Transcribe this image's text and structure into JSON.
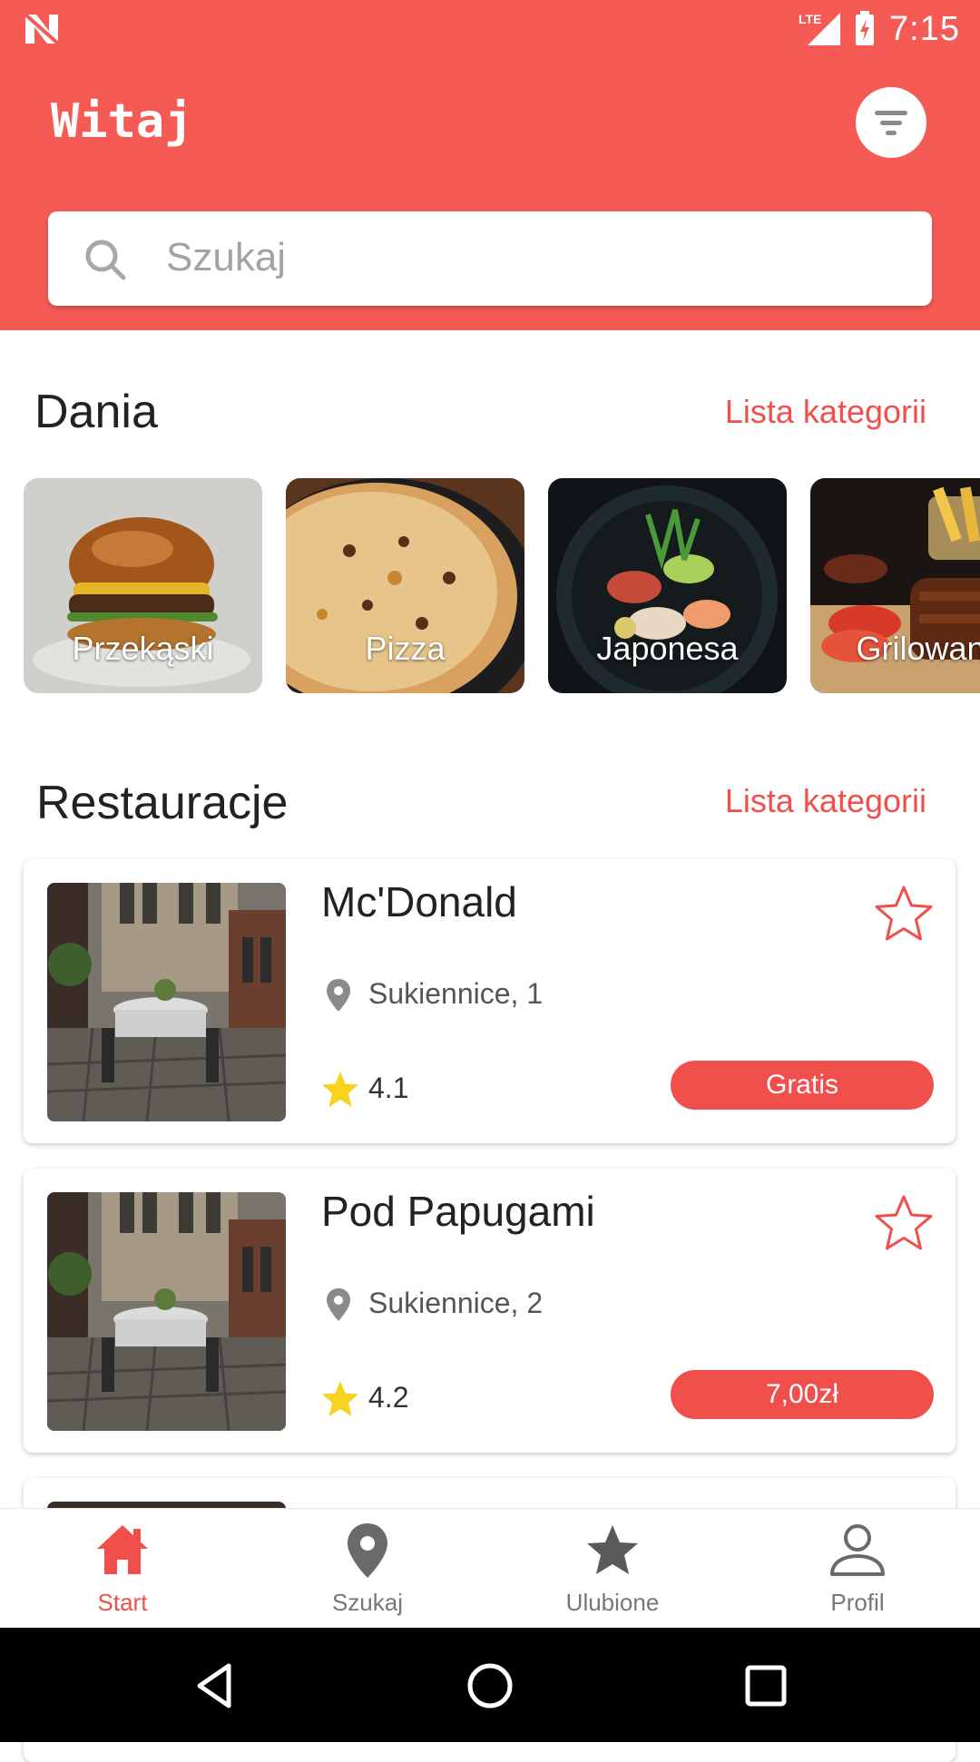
{
  "status_bar": {
    "time": "7:15",
    "network": "LTE"
  },
  "header": {
    "greeting": "Witaj",
    "search_placeholder": "Szukaj"
  },
  "dishes": {
    "title": "Dania",
    "link": "Lista kategorii",
    "categories": [
      {
        "label": "Przekąski"
      },
      {
        "label": "Pizza"
      },
      {
        "label": "Japonesa"
      },
      {
        "label": "Grilowane"
      }
    ]
  },
  "restaurants": {
    "title": "Restauracje",
    "link": "Lista kategorii",
    "items": [
      {
        "name": "Mc'Donald",
        "address": "Sukiennice, 1",
        "rating": "4.1",
        "price": "Gratis"
      },
      {
        "name": "Pod Papugami",
        "address": "Sukiennice, 2",
        "rating": "4.2",
        "price": "7,00zł"
      }
    ]
  },
  "bottom_nav": [
    {
      "label": "Start",
      "icon": "home-icon",
      "active": true
    },
    {
      "label": "Szukaj",
      "icon": "map-pin-icon",
      "active": false
    },
    {
      "label": "Ulubione",
      "icon": "star-icon",
      "active": false
    },
    {
      "label": "Profil",
      "icon": "person-icon",
      "active": false
    }
  ],
  "colors": {
    "accent": "#f04f4c",
    "header": "#f55a55"
  }
}
